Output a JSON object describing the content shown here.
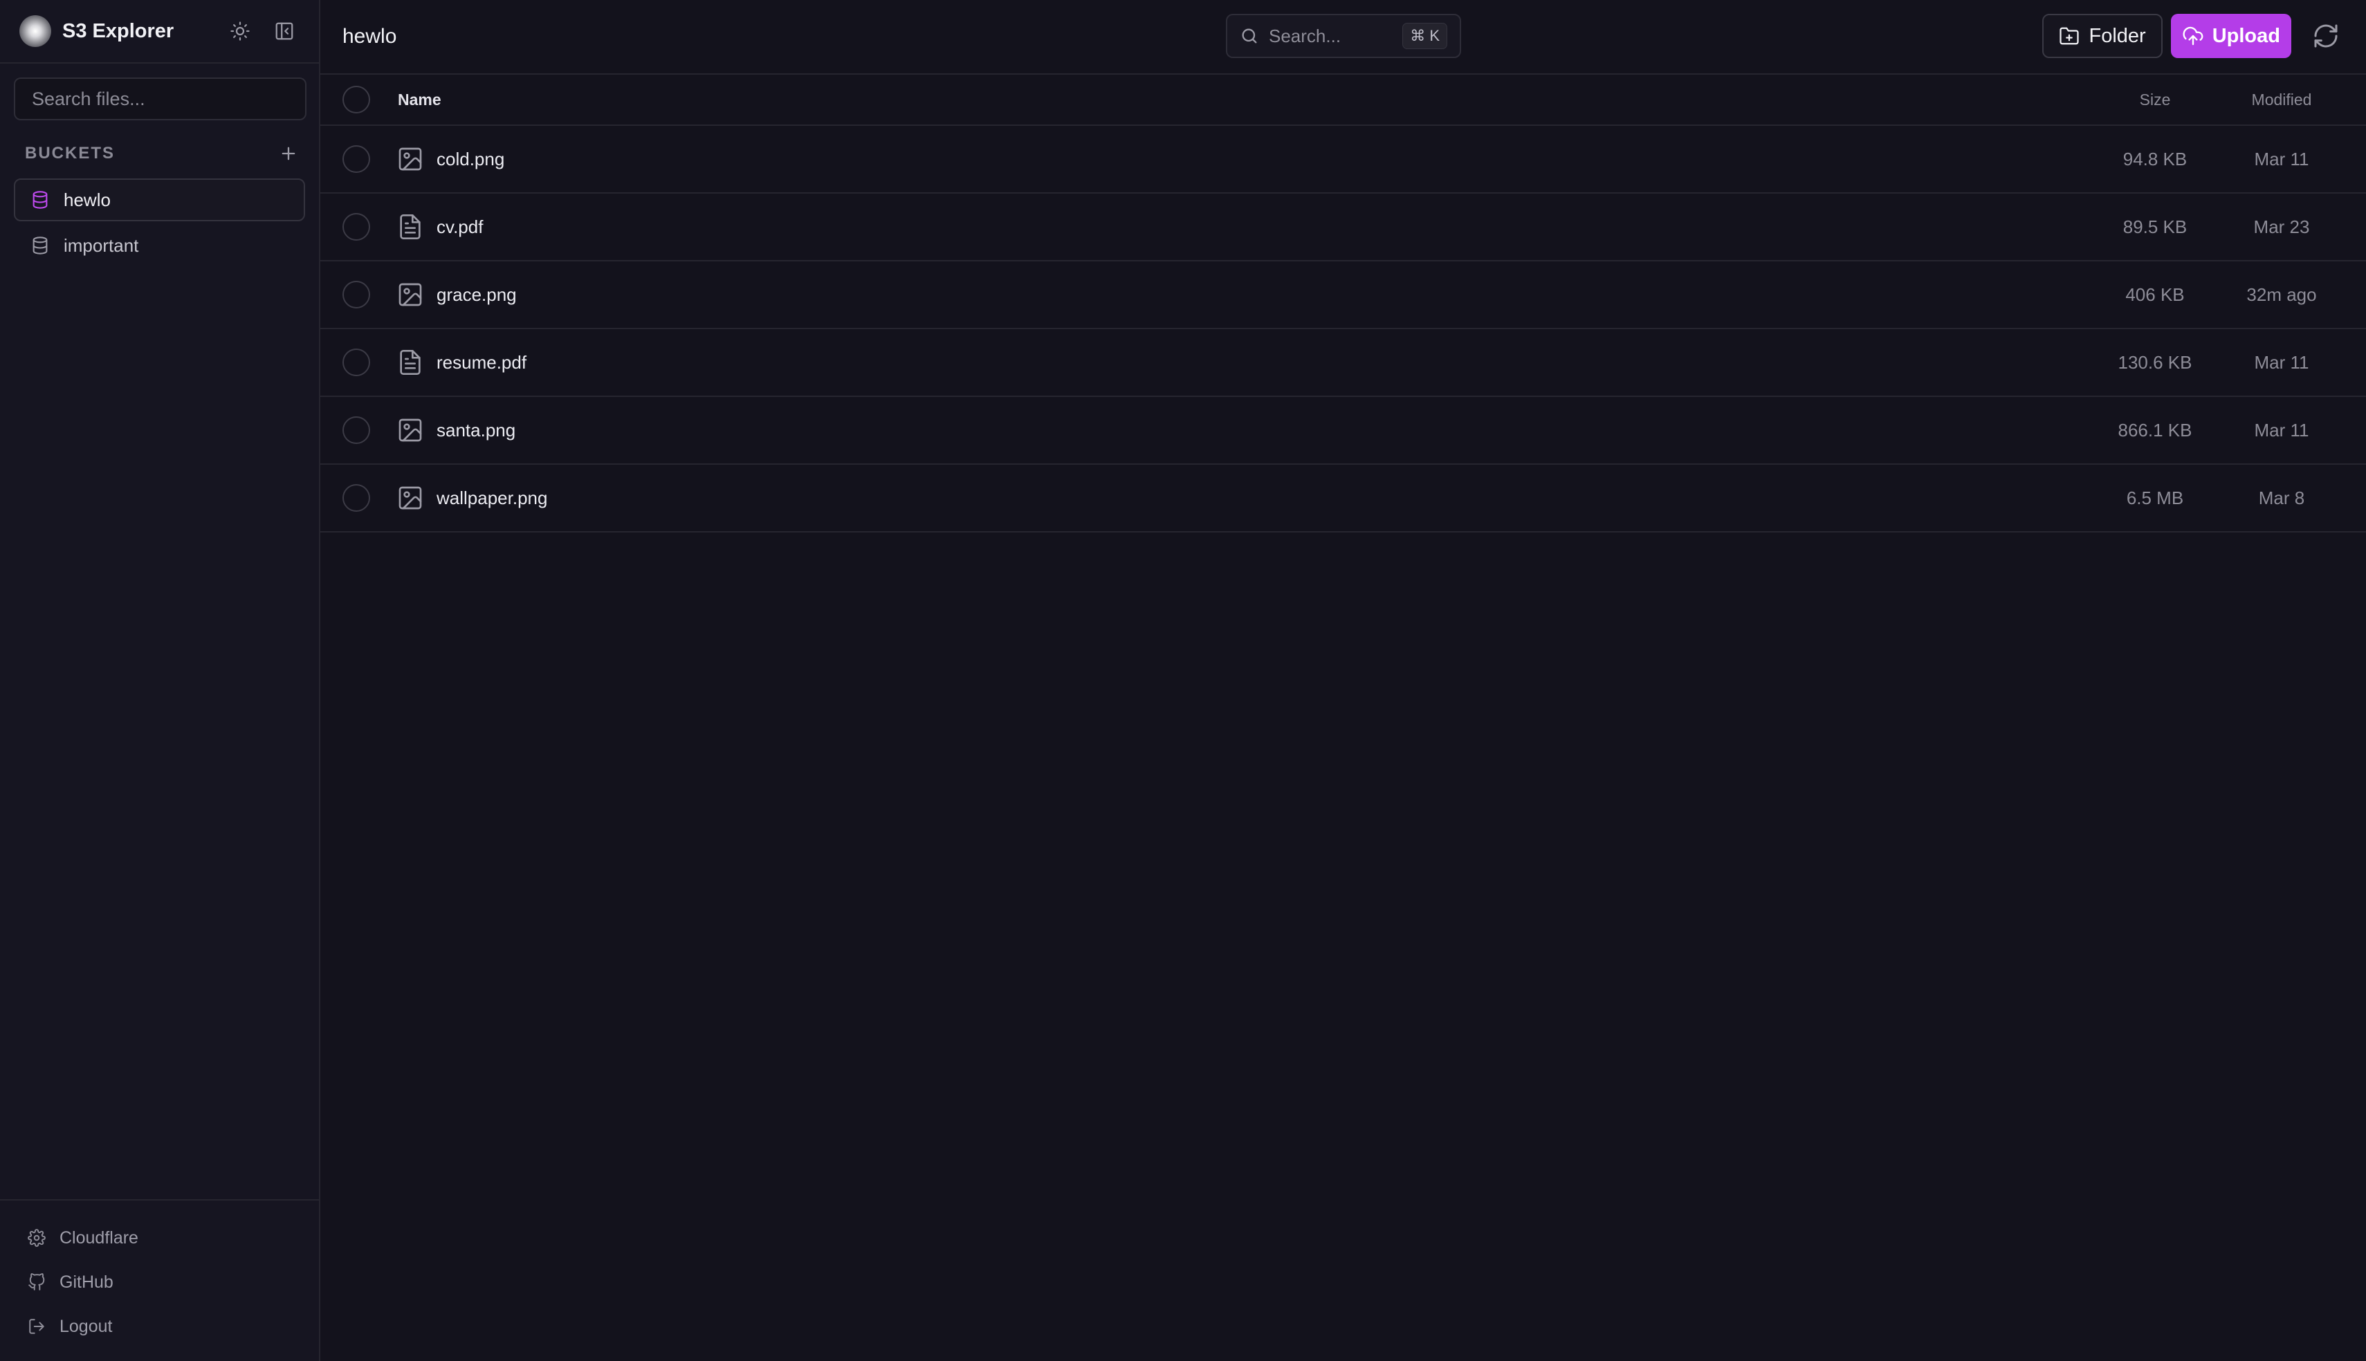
{
  "app": {
    "title": "S3 Explorer"
  },
  "sidebar": {
    "search_placeholder": "Search files...",
    "buckets_label": "BUCKETS",
    "buckets": [
      {
        "label": "hewlo",
        "active": true
      },
      {
        "label": "important",
        "active": false
      }
    ],
    "footer": [
      {
        "label": "Cloudflare",
        "icon": "gear-icon"
      },
      {
        "label": "GitHub",
        "icon": "github-icon"
      },
      {
        "label": "Logout",
        "icon": "logout-icon"
      }
    ]
  },
  "topbar": {
    "breadcrumb": "hewlo",
    "search_placeholder": "Search...",
    "shortcut": "⌘ K",
    "folder_label": "Folder",
    "upload_label": "Upload"
  },
  "table": {
    "headers": {
      "name": "Name",
      "size": "Size",
      "modified": "Modified"
    },
    "rows": [
      {
        "name": "cold.png",
        "type": "image",
        "size": "94.8 KB",
        "modified": "Mar 11"
      },
      {
        "name": "cv.pdf",
        "type": "document",
        "size": "89.5 KB",
        "modified": "Mar 23"
      },
      {
        "name": "grace.png",
        "type": "image",
        "size": "406 KB",
        "modified": "32m ago"
      },
      {
        "name": "resume.pdf",
        "type": "document",
        "size": "130.6 KB",
        "modified": "Mar 11"
      },
      {
        "name": "santa.png",
        "type": "image",
        "size": "866.1 KB",
        "modified": "Mar 11"
      },
      {
        "name": "wallpaper.png",
        "type": "image",
        "size": "6.5 MB",
        "modified": "Mar 8"
      }
    ]
  },
  "colors": {
    "accent": "#b43de8",
    "active_bucket_icon": "#c04bf0",
    "background": "#13121c",
    "sidebar": "#161521"
  }
}
